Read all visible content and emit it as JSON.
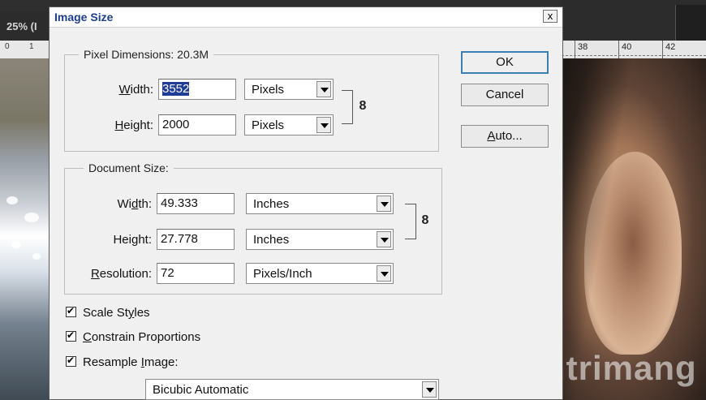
{
  "app": {
    "doc_tab_label": "25% (I",
    "left_ruler_labels": [
      "0",
      "1"
    ],
    "right_ruler_labels": [
      "38",
      "40",
      "42"
    ]
  },
  "watermark": {
    "text": "uantrimang"
  },
  "dialog": {
    "title": "Image Size",
    "close_glyph": "x",
    "pixel_dimensions": {
      "legend": "Pixel Dimensions:  20.3M",
      "width": {
        "label_pre": "",
        "label_u": "W",
        "label_post": "idth:",
        "value": "3552",
        "unit": "Pixels"
      },
      "height": {
        "label_pre": "",
        "label_u": "H",
        "label_post": "eight:",
        "value": "2000",
        "unit": "Pixels"
      },
      "link_glyph": "8"
    },
    "document_size": {
      "legend": "Document Size:",
      "width": {
        "label_pre": "Wi",
        "label_u": "d",
        "label_post": "th:",
        "value": "49.333",
        "unit": "Inches"
      },
      "height": {
        "label_pre": "Hei",
        "label_u": "g",
        "label_post": "ht:",
        "value": "27.778",
        "unit": "Inches"
      },
      "resolution": {
        "label_pre": "",
        "label_u": "R",
        "label_post": "esolution:",
        "value": "72",
        "unit": "Pixels/Inch"
      },
      "link_glyph": "8"
    },
    "buttons": {
      "ok": "OK",
      "cancel": "Cancel",
      "auto_u": "A",
      "auto_rest": "uto..."
    },
    "options": {
      "scale_styles": {
        "pre": "Scale St",
        "u": "y",
        "post": "les",
        "checked": true
      },
      "constrain": {
        "pre": "",
        "u": "C",
        "post": "onstrain Proportions",
        "checked": true
      },
      "resample": {
        "pre": "Resample ",
        "u": "I",
        "post": "mage:",
        "checked": true
      },
      "resample_method": "Bicubic Automatic"
    }
  },
  "colors": {
    "title_text": "#1c3e8c",
    "selection_bg": "#1f3c96",
    "default_button_border": "#3c7fb1"
  }
}
